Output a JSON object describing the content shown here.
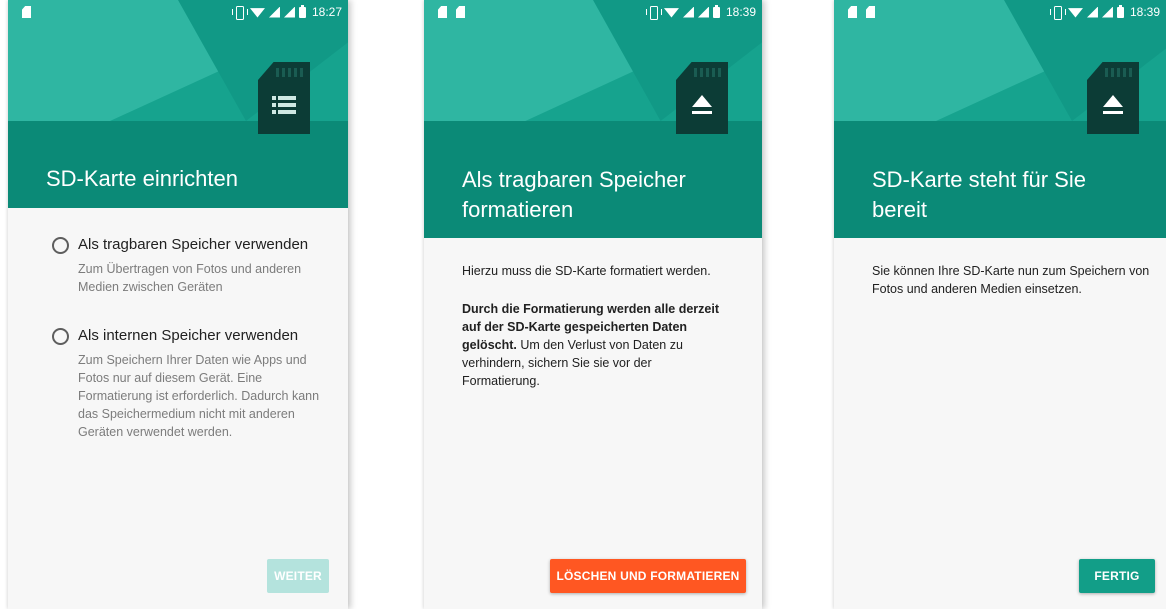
{
  "screens": [
    {
      "status_time": "18:27",
      "title": "SD-Karte einrichten",
      "options": [
        {
          "label": "Als tragbaren Speicher verwenden",
          "description": "Zum Übertragen von Fotos und anderen Medien zwischen Geräten"
        },
        {
          "label": "Als internen Speicher verwenden",
          "description": "Zum Speichern Ihrer Daten wie Apps und Fotos nur auf diesem Gerät. Eine Formatierung ist erforderlich. Dadurch kann das Speichermedium nicht mit anderen Geräten verwendet werden."
        }
      ],
      "button_label": "WEITER"
    },
    {
      "status_time": "18:39",
      "title_line1": "Als tragbaren Speicher",
      "title_line2": "formatieren",
      "text_intro": "Hierzu muss die SD-Karte formatiert werden.",
      "warning_bold": "Durch die Formatierung werden alle derzeit auf der SD-Karte gespeicherten Daten gelöscht.",
      "warning_rest": " Um den Verlust von Daten zu verhindern, sichern Sie sie vor der Formatierung.",
      "button_label": "LÖSCHEN UND FORMATIEREN"
    },
    {
      "status_time": "18:39",
      "title_line1": "SD-Karte steht für Sie",
      "title_line2": "bereit",
      "text": "Sie können Ihre SD-Karte nun zum Speichern von Fotos und anderen Medien einsetzen.",
      "button_label": "FERTIG"
    }
  ],
  "colors": {
    "header_dark": "#0b8a77",
    "header_light": "#2fb6a2",
    "button_disabled": "#b4e3dd",
    "button_danger": "#ff5722",
    "button_primary": "#129e88"
  },
  "icons": [
    "sd-card-icon",
    "storage-list-icon",
    "eject-icon",
    "vibrate-icon",
    "wifi-icon",
    "signal-icon",
    "battery-icon"
  ]
}
